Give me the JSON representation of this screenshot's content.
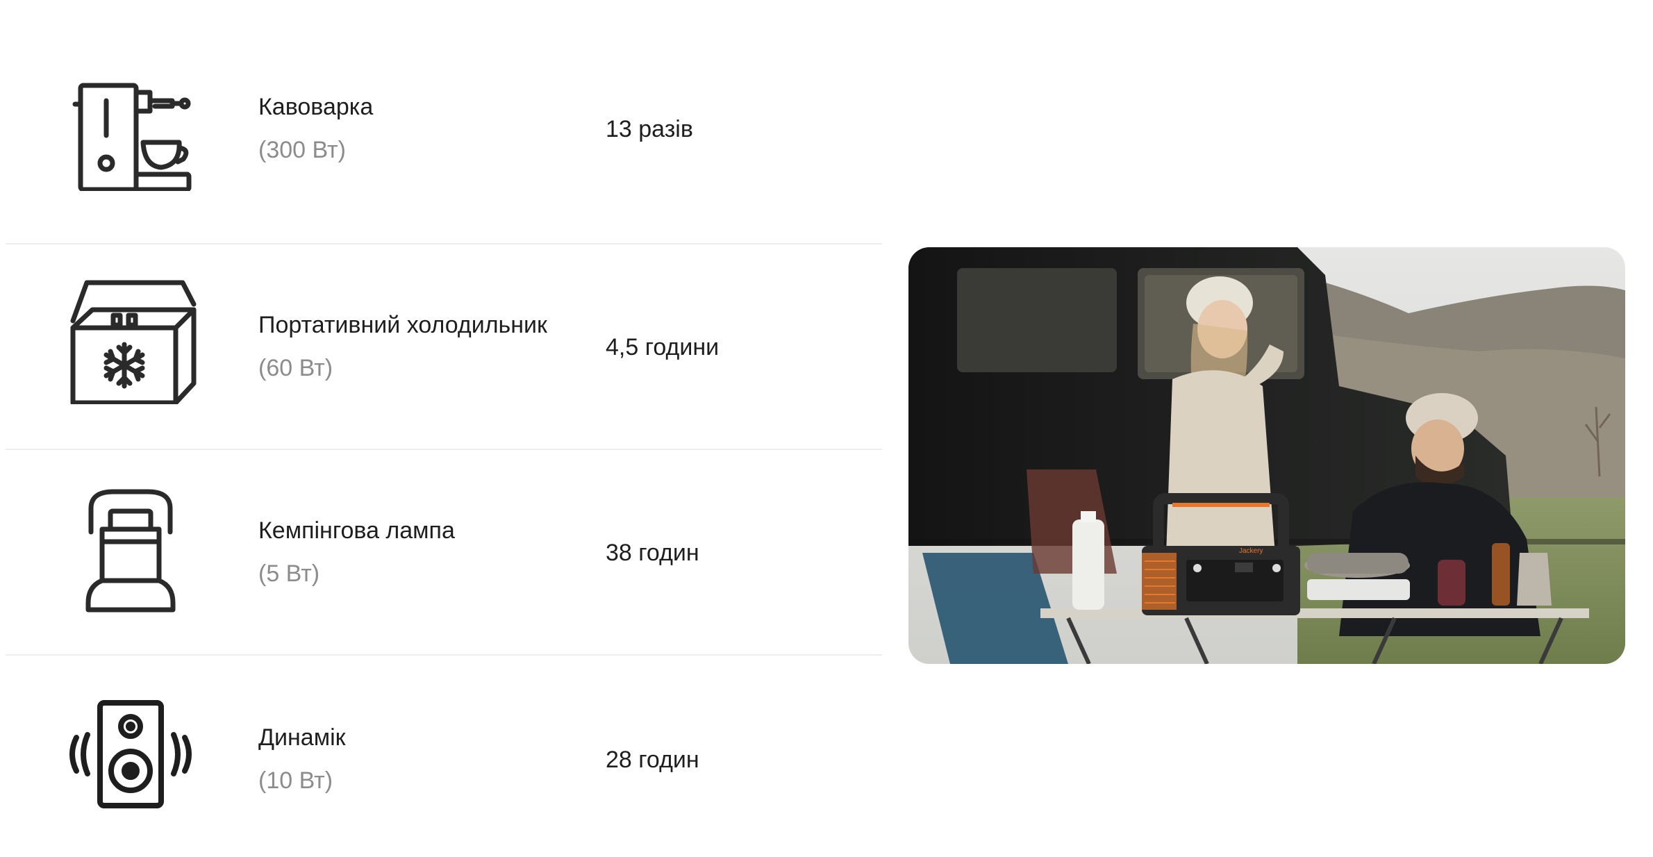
{
  "appliances": [
    {
      "name": "Кавоварка",
      "power": "(300 Вт)",
      "value": "13 разів",
      "icon": "coffee-maker-icon"
    },
    {
      "name": "Портативний холодильник",
      "power": "(60 Вт)",
      "value": "4,5 години",
      "icon": "portable-fridge-icon"
    },
    {
      "name": "Кемпінгова лампа",
      "power": "(5 Вт)",
      "value": "38 годин",
      "icon": "camping-lamp-icon"
    },
    {
      "name": "Динамік",
      "power": "(10 Вт)",
      "value": "28 годин",
      "icon": "speaker-icon"
    }
  ],
  "photo": {
    "description_icon": "camping-photo",
    "device_label": "Jackery"
  },
  "colors": {
    "text": "#1e1e1e",
    "muted": "#8c8c8c",
    "divider": "#ececec",
    "icon": "#2a2a2a",
    "accent": "#e8772e"
  }
}
